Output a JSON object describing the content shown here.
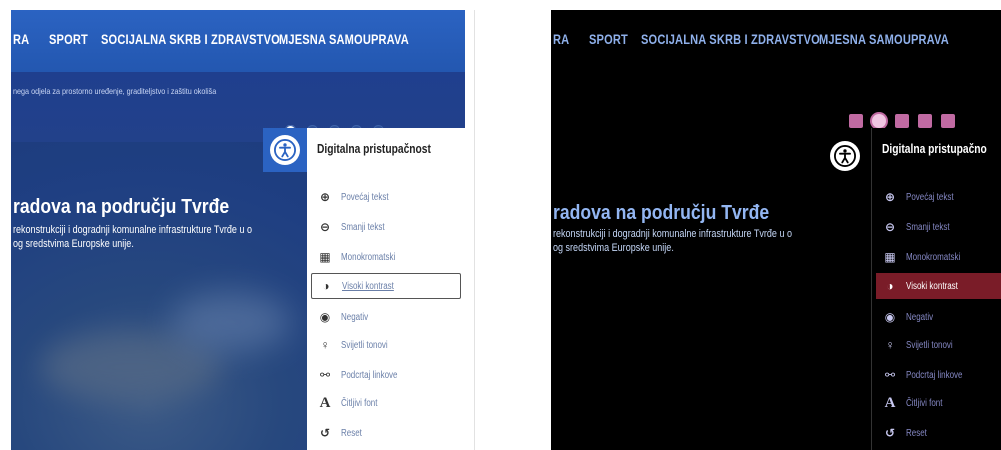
{
  "nav": [
    "RA",
    "SPORT",
    "SOCIJALNA SKRB I ZDRAVSTVO",
    "MJESNA SAMOUPRAVA"
  ],
  "subtitle": "nega odjela za prostorno uređenje, graditeljstvo i zaštitu okoliša",
  "hero": {
    "title": "radova na području Tvrđe",
    "line1": "rekonstrukciji i dogradnji komunalne infrastrukture Tvrđe u o",
    "line2": "og sredstvima Europske unije."
  },
  "accessibility": {
    "title": "Digitalna pristupačnost",
    "title_right": "Digitalna pristupačno",
    "items": [
      {
        "label": "Povećaj tekst",
        "icon": "zoom-in-icon"
      },
      {
        "label": "Smanji tekst",
        "icon": "zoom-out-icon"
      },
      {
        "label": "Monokromatski",
        "icon": "grayscale-icon"
      },
      {
        "label": "Visoki kontrast",
        "icon": "contrast-icon"
      },
      {
        "label": "Negativ",
        "icon": "eye-icon"
      },
      {
        "label": "Svijetli tonovi",
        "icon": "lightbulb-icon"
      },
      {
        "label": "Podcrtaj linkove",
        "icon": "link-icon"
      },
      {
        "label": "Čitljivi font",
        "icon": "font-icon"
      },
      {
        "label": "Reset",
        "icon": "reset-icon"
      }
    ],
    "active_index": 3
  },
  "colors": {
    "left_nav_bg": "#2b63c2",
    "right_dot_color": "#c06aa2",
    "right_active_bg": "#7a1c28"
  }
}
